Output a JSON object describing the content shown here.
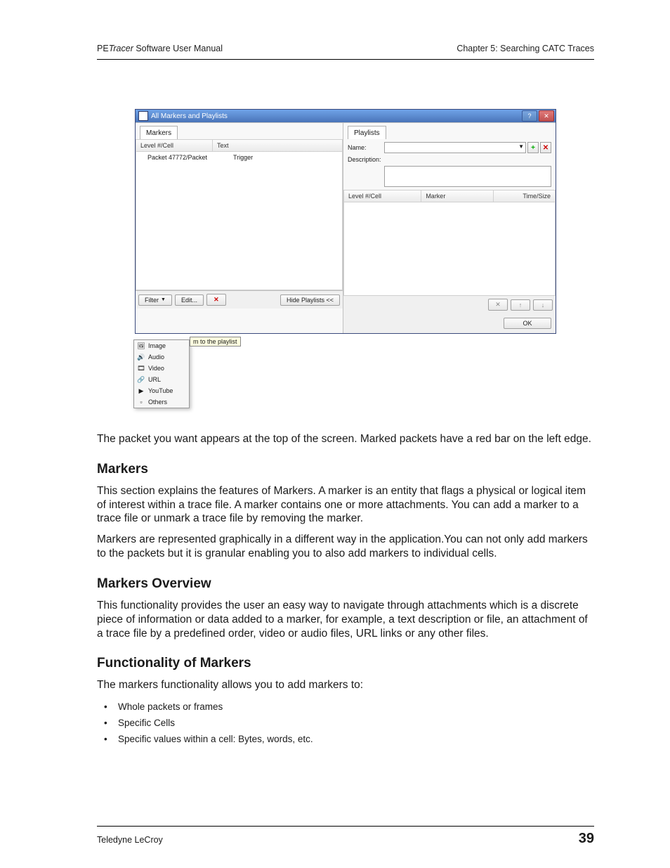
{
  "header": {
    "left_pre": "PE",
    "left_italic": "Tracer",
    "left_post": " Software User Manual",
    "right": "Chapter 5: Searching CATC Traces"
  },
  "dialog": {
    "title": "All Markers and Playlists",
    "left": {
      "tab": "Markers",
      "col1": "Level #/Cell",
      "col2": "Text",
      "row_level": "Packet 47772/Packet",
      "row_text": "Trigger",
      "filter_btn": "Filter",
      "edit_btn": "Edit...",
      "hide_btn": "Hide Playlists <<"
    },
    "popup": {
      "items": [
        "Image",
        "Audio",
        "Video",
        "URL",
        "YouTube",
        "Others"
      ]
    },
    "tooltip": "m to the playlist",
    "right": {
      "tab": "Playlists",
      "name_label": "Name:",
      "desc_label": "Description:",
      "col1": "Level #/Cell",
      "col2": "Marker",
      "col3": "Time/Size",
      "ok_btn": "OK"
    }
  },
  "article": {
    "p_intro": "The packet you want appears at the top of the screen. Marked packets have a red bar on the left edge.",
    "h_markers": "Markers",
    "p_markers_1": "This section explains the features of Markers. A marker is an entity that flags a physical or logical item of interest within a trace file. A marker contains one or more attachments. You can add a marker to a trace file or unmark a trace file by removing the marker.",
    "p_markers_2": "Markers are represented graphically in a different way in the application.You can not only add markers to the packets but it is granular enabling you to also add markers to individual cells.",
    "h_overview": "Markers Overview",
    "p_overview": "This functionality provides the user an easy way to navigate through attachments which is a discrete piece of information or data added to a marker, for example, a text description or file, an attachment of a trace file by a predefined order, video or audio files, URL links or any other files.",
    "h_func": "Functionality of Markers",
    "p_func": "The markers functionality allows you to add markers to:",
    "bullets": [
      "Whole packets or frames",
      "Specific Cells",
      "Specific values within a cell: Bytes, words, etc."
    ]
  },
  "footer": {
    "left": "Teledyne LeCroy",
    "page": "39"
  }
}
